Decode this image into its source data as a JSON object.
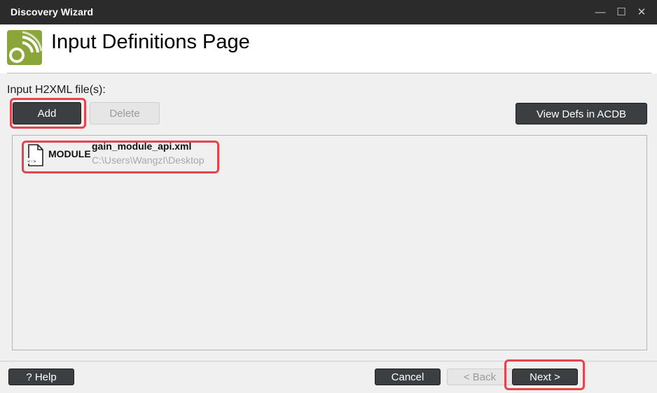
{
  "window": {
    "title": "Discovery Wizard",
    "controls": {
      "minimize": "—",
      "maximize": "☐",
      "close": "✕"
    }
  },
  "header": {
    "title": "Input Definitions Page",
    "logo_icon": "wifi-gear-icon"
  },
  "input_section": {
    "label": "Input H2XML file(s):",
    "add_label": "Add",
    "delete_label": "Delete",
    "view_defs_label": "View Defs in ACDB"
  },
  "files": [
    {
      "type": "MODULE",
      "name": "gain_module_api.xml",
      "path": "C:\\Users\\WangzI\\Desktop",
      "icon": "xml-file-icon"
    }
  ],
  "footer": {
    "help_label": "? Help",
    "cancel_label": "Cancel",
    "back_label": "< Back",
    "next_label": "Next >"
  },
  "colors": {
    "titlebar": "#2b2b2b",
    "button_dark": "#3c3f41",
    "highlight": "#e8434c",
    "logo_green": "#8aa63a"
  }
}
